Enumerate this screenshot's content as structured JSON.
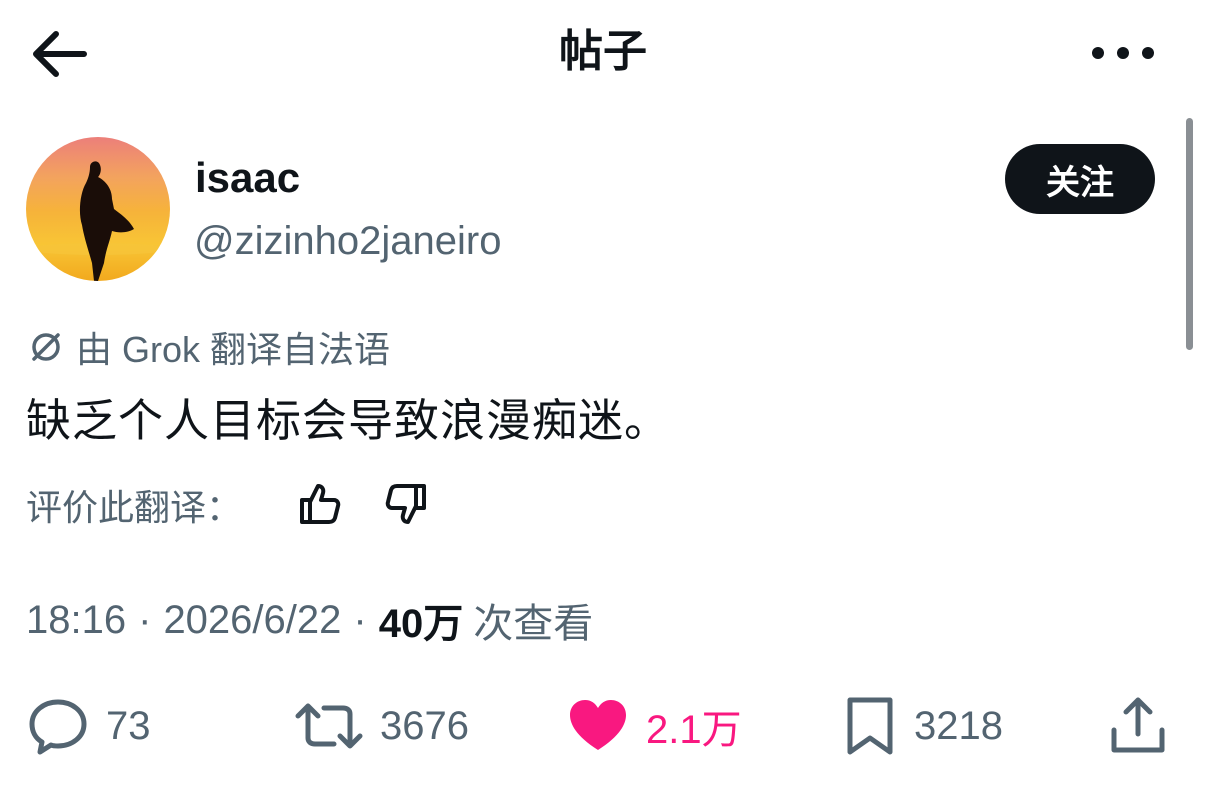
{
  "header": {
    "title": "帖子",
    "back_icon": "arrow-left-icon",
    "more_icon": "more-horizontal-icon"
  },
  "author": {
    "display_name": "isaac",
    "handle": "@zizinho2janeiro",
    "follow_label": "关注"
  },
  "translation": {
    "note": "由 Grok 翻译自法语",
    "rate_label": "评价此翻译："
  },
  "tweet": {
    "text": "缺乏个人目标会导致浪漫痴迷。"
  },
  "meta": {
    "time": "18:16",
    "date": "2026/6/22",
    "views_count": "40万",
    "views_label": "次查看"
  },
  "actions": {
    "reply_count": "73",
    "retweet_count": "3676",
    "like_count": "2.1万",
    "bookmark_count": "3218"
  },
  "colors": {
    "like": "#f91880",
    "secondary_text": "#536471",
    "primary_text": "#0f1419",
    "follow_bg": "#0f1419"
  }
}
